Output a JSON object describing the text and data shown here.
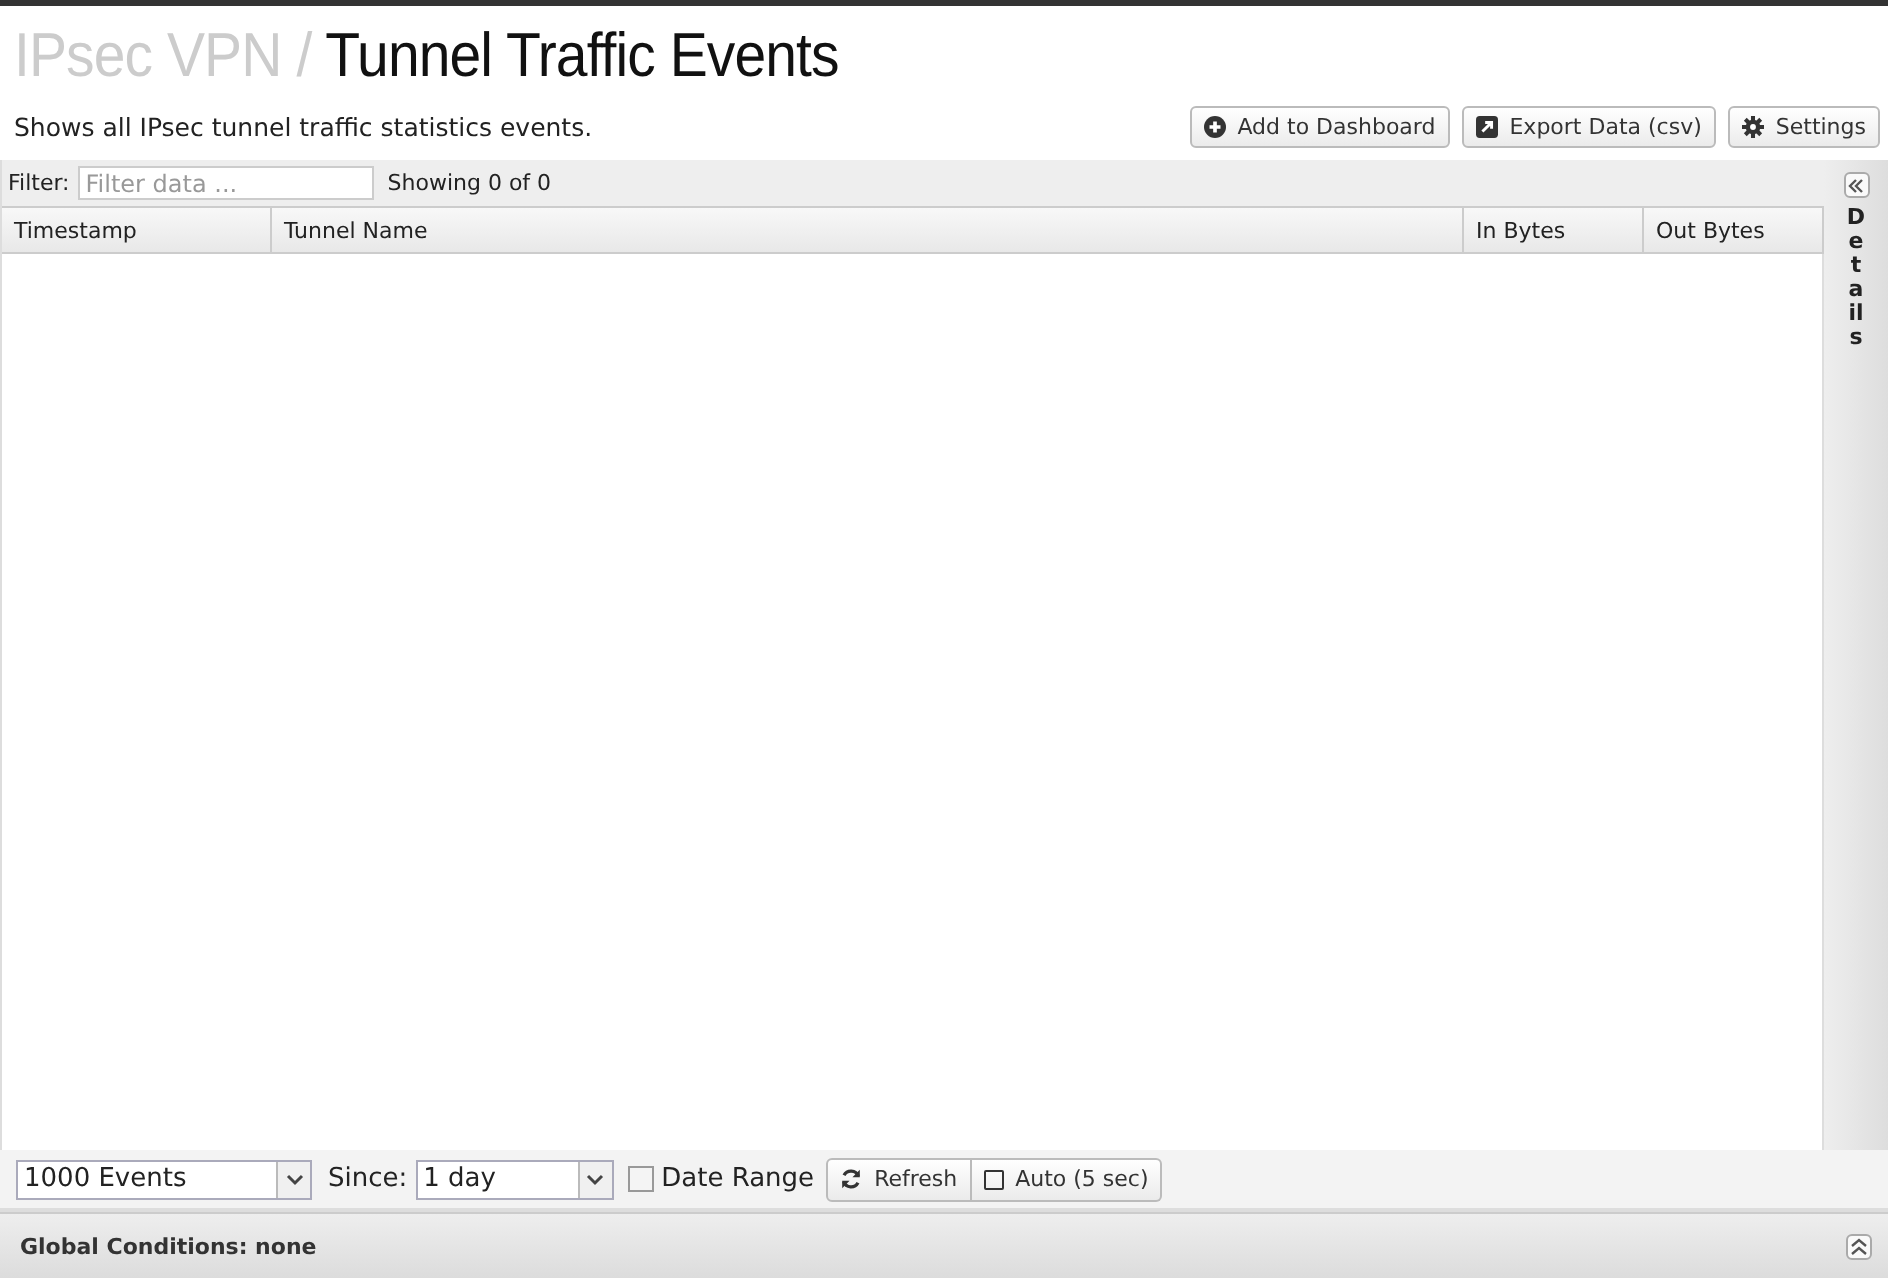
{
  "breadcrumb": {
    "parent": "IPsec VPN /",
    "title": "Tunnel Traffic Events"
  },
  "description": "Shows all IPsec tunnel traffic statistics events.",
  "actions": [
    {
      "kind": "add",
      "label": "Add to Dashboard"
    },
    {
      "kind": "export",
      "label": "Export Data (csv)"
    },
    {
      "kind": "settings",
      "label": "Settings"
    }
  ],
  "filter": {
    "label": "Filter:",
    "placeholder": "Filter data ...",
    "count": "Showing 0 of 0"
  },
  "table": {
    "columns": [
      "Timestamp",
      "Tunnel Name",
      "In Bytes",
      "Out Bytes"
    ]
  },
  "details_panel": {
    "label": "Details"
  },
  "footer": {
    "limit": "1000 Events",
    "since_label": "Since:",
    "since": "1 day",
    "date_range": {
      "label": "Date Range",
      "checked": false
    },
    "refresh": "Refresh",
    "auto": {
      "label": "Auto (5 sec)",
      "checked": false
    }
  },
  "global_conditions": "Global Conditions: none"
}
